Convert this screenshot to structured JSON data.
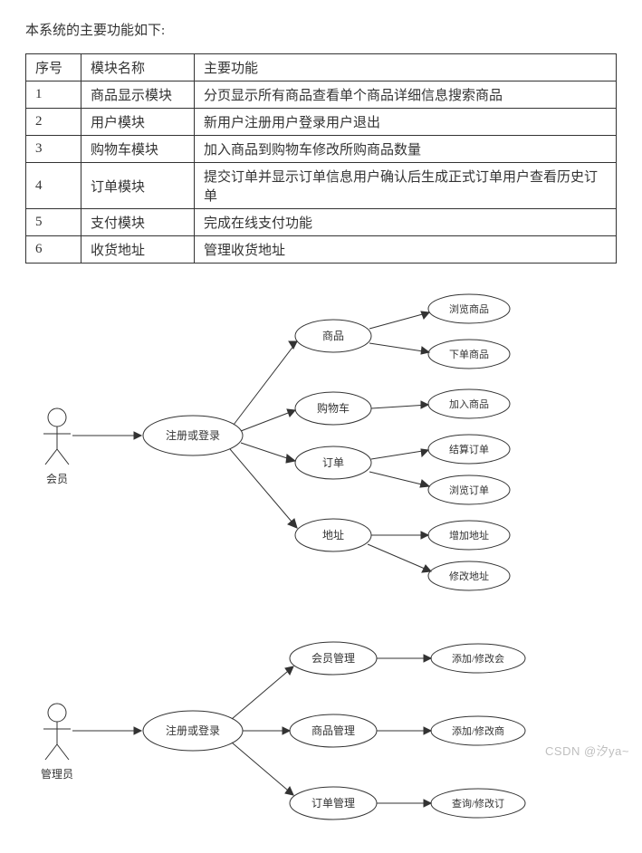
{
  "intro": "本系统的主要功能如下:",
  "table": {
    "headers": {
      "c1": "序号",
      "c2": "模块名称",
      "c3": "主要功能"
    },
    "rows": [
      {
        "num": "1",
        "mod": "商品显示模块",
        "func": "分页显示所有商品查看单个商品详细信息搜索商品"
      },
      {
        "num": "2",
        "mod": "用户模块",
        "func": "新用户注册用户登录用户退出"
      },
      {
        "num": "3",
        "mod": "购物车模块",
        "func": "加入商品到购物车修改所购商品数量"
      },
      {
        "num": "4",
        "mod": "订单模块",
        "func": "提交订单并显示订单信息用户确认后生成正式订单用户查看历史订单"
      },
      {
        "num": "5",
        "mod": "支付模块",
        "func": "完成在线支付功能"
      },
      {
        "num": "6",
        "mod": "收货地址",
        "func": "管理收货地址"
      }
    ]
  },
  "diagram1": {
    "actor": "会员",
    "root": "注册或登录",
    "groups": [
      {
        "name": "商品",
        "leaves": [
          "浏览商品",
          "下单商品"
        ]
      },
      {
        "name": "购物车",
        "leaves": [
          "加入商品"
        ]
      },
      {
        "name": "订单",
        "leaves": [
          "结算订单",
          "浏览订单"
        ]
      },
      {
        "name": "地址",
        "leaves": [
          "增加地址",
          "修改地址"
        ]
      }
    ]
  },
  "diagram2": {
    "actor": "管理员",
    "root": "注册或登录",
    "groups": [
      {
        "name": "会员管理",
        "leaves": [
          "添加/修改会"
        ]
      },
      {
        "name": "商品管理",
        "leaves": [
          "添加/修改商"
        ]
      },
      {
        "name": "订单管理",
        "leaves": [
          "查询/修改订"
        ]
      }
    ]
  },
  "watermark": "CSDN @汐ya~"
}
